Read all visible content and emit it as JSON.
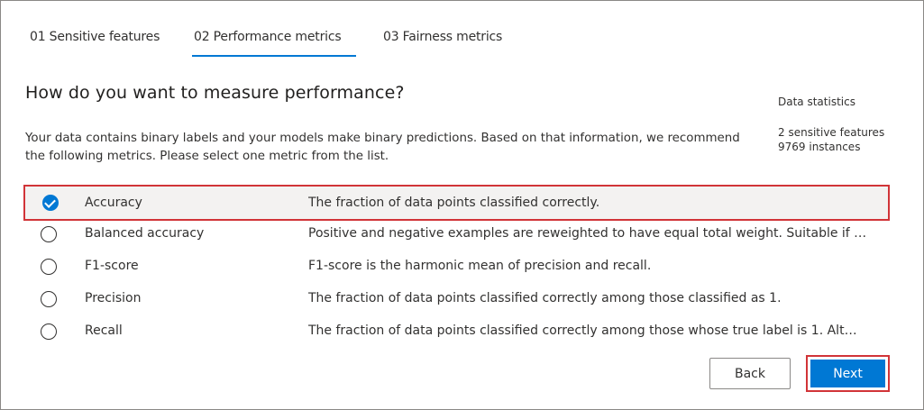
{
  "tabs": [
    {
      "label": "01 Sensitive features"
    },
    {
      "label": "02 Performance metrics"
    },
    {
      "label": "03 Fairness metrics"
    }
  ],
  "active_tab_index": 1,
  "accent_color": "#0078d4",
  "highlight_color": "#d13438",
  "heading": "How do you want to measure performance?",
  "description": "Your data contains binary labels and your models make binary predictions. Based on that information, we recommend the following metrics. Please select one metric from the list.",
  "stats": {
    "title": "Data statistics",
    "features": "2 sensitive features",
    "instances": "9769 instances"
  },
  "metrics": [
    {
      "name": "Accuracy",
      "description": "The fraction of data points classified correctly.",
      "selected": true
    },
    {
      "name": "Balanced accuracy",
      "description": "Positive and negative examples are reweighted to have equal total weight. Suitable if …",
      "selected": false
    },
    {
      "name": "F1-score",
      "description": "F1-score is the harmonic mean of precision and recall.",
      "selected": false
    },
    {
      "name": "Precision",
      "description": "The fraction of data points classified correctly among those classified as 1.",
      "selected": false
    },
    {
      "name": "Recall",
      "description": "The fraction of data points classified correctly among those whose true label is 1. Alt…",
      "selected": false
    }
  ],
  "buttons": {
    "back": "Back",
    "next": "Next"
  }
}
